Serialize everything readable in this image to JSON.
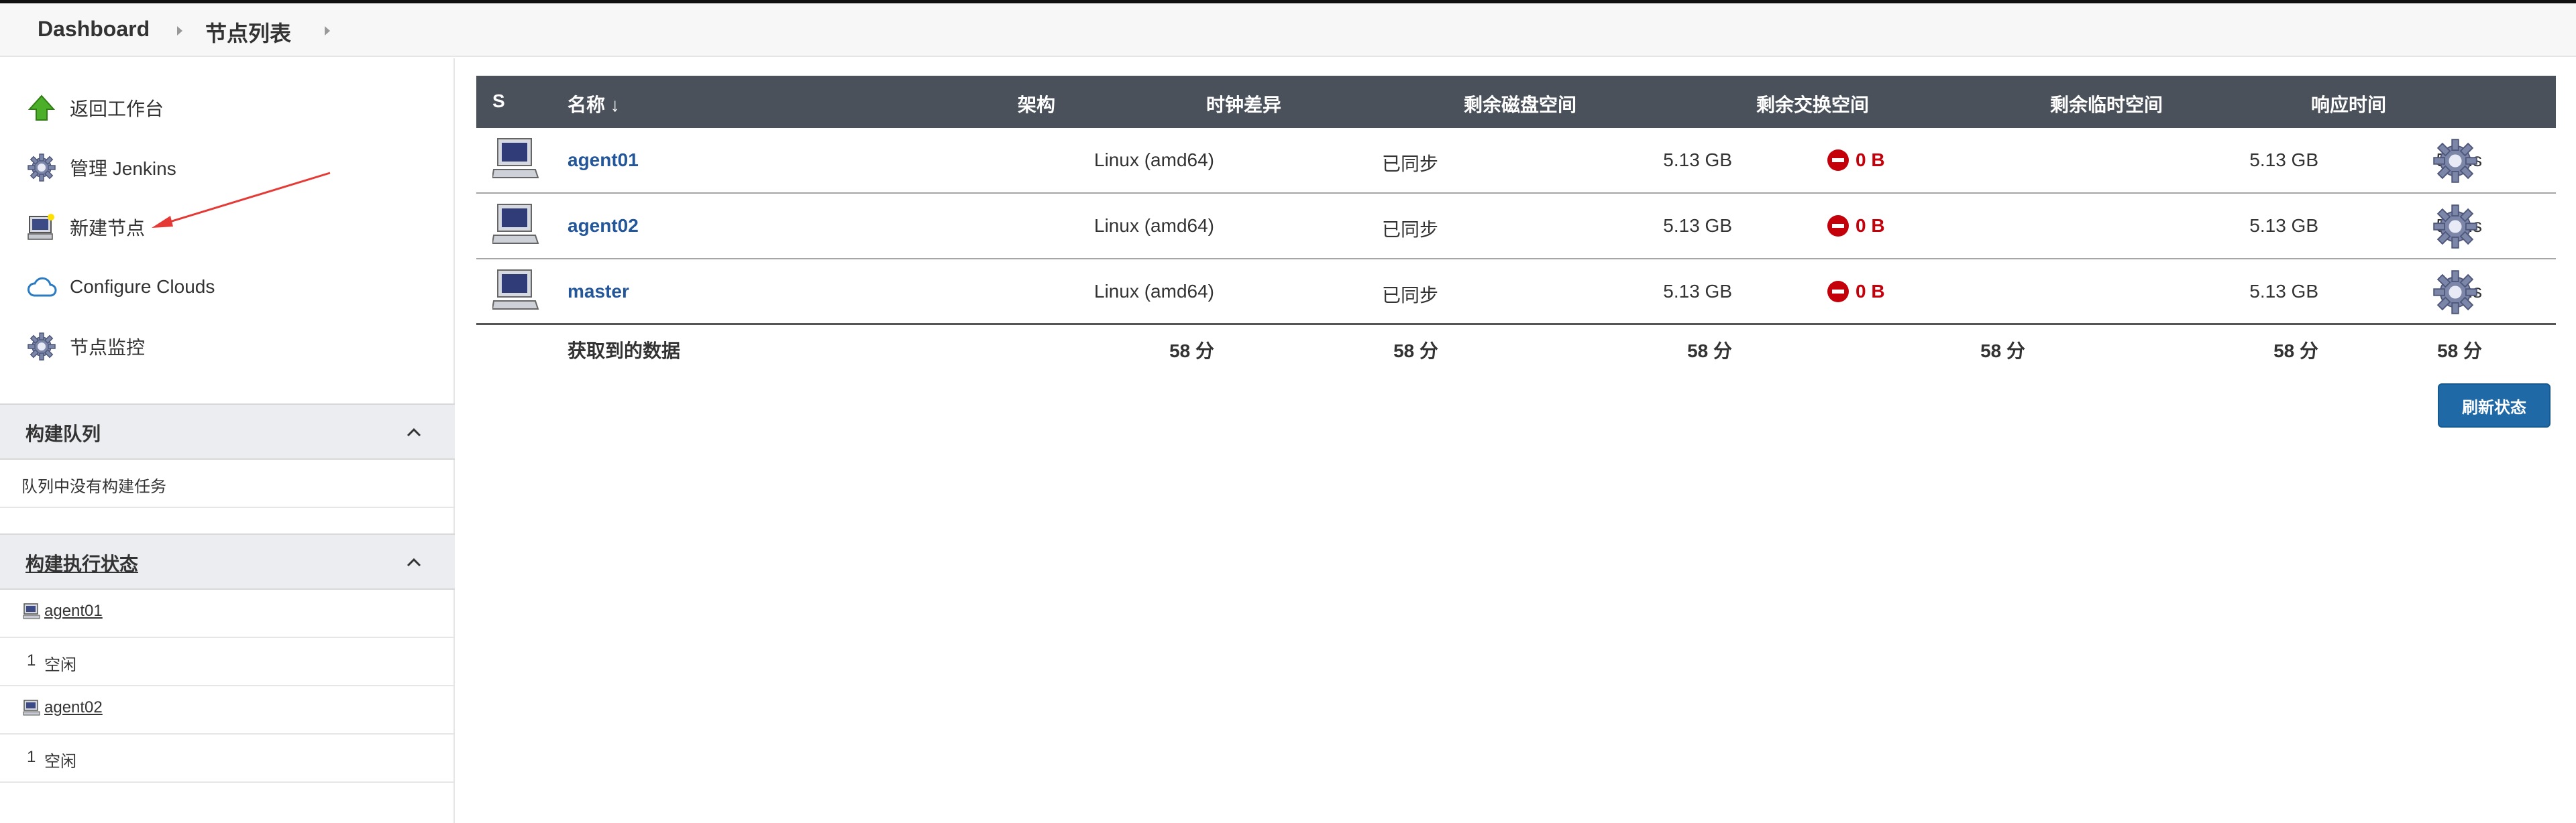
{
  "breadcrumb": {
    "items": [
      "Dashboard",
      "节点列表"
    ]
  },
  "sidebar": {
    "tasks": [
      {
        "label": "返回工作台",
        "icon": "up-arrow-icon"
      },
      {
        "label": "管理 Jenkins",
        "icon": "gear-icon"
      },
      {
        "label": "新建节点",
        "icon": "computer-new-icon"
      },
      {
        "label": "Configure Clouds",
        "icon": "cloud-icon"
      },
      {
        "label": "节点监控",
        "icon": "gear-icon"
      }
    ],
    "build_queue": {
      "title": "构建队列",
      "empty_text": "队列中没有构建任务"
    },
    "executors": {
      "title": "构建执行状态",
      "nodes": [
        {
          "name": "agent01",
          "slot": "1",
          "status": "空闲"
        },
        {
          "name": "agent02",
          "slot": "1",
          "status": "空闲"
        }
      ]
    }
  },
  "table": {
    "headers": {
      "s": "S",
      "name": "名称 ↓",
      "arch": "架构",
      "clock": "时钟差异",
      "disk": "剩余磁盘空间",
      "swap": "剩余交换空间",
      "temp": "剩余临时空间",
      "response": "响应时间"
    },
    "rows": [
      {
        "name": "agent01",
        "arch": "Linux (amd64)",
        "clock": "已同步",
        "disk": "5.13 GB",
        "swap": "0 B",
        "temp": "5.13 GB",
        "response": "59ms"
      },
      {
        "name": "agent02",
        "arch": "Linux (amd64)",
        "clock": "已同步",
        "disk": "5.13 GB",
        "swap": "0 B",
        "temp": "5.13 GB",
        "response": "56ms"
      },
      {
        "name": "master",
        "arch": "Linux (amd64)",
        "clock": "已同步",
        "disk": "5.13 GB",
        "swap": "0 B",
        "temp": "5.13 GB",
        "response": "0ms"
      }
    ],
    "footer": {
      "label": "获取到的数据",
      "arch": "58 分",
      "clock": "58 分",
      "disk": "58 分",
      "swap": "58 分",
      "temp": "58 分",
      "response": "58 分"
    }
  },
  "refresh_button": "刷新状态",
  "colors": {
    "header_bg": "#4b515b",
    "link": "#24569a",
    "error": "#c4000a",
    "button": "#1f69a7"
  }
}
